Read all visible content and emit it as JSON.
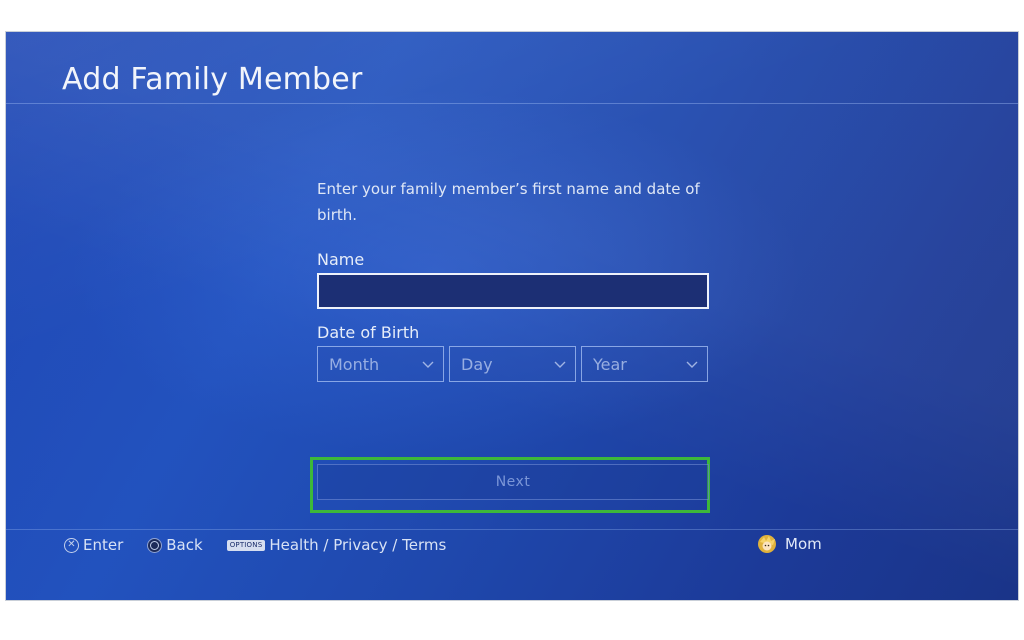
{
  "header": {
    "title": "Add Family Member"
  },
  "form": {
    "instructions": "Enter your family member’s first name and date of birth.",
    "name_label": "Name",
    "name_value": "",
    "dob_label": "Date of Birth",
    "dob": {
      "month_label": "Month",
      "day_label": "Day",
      "year_label": "Year"
    },
    "next_label": "Next"
  },
  "footer": {
    "enter_label": "Enter",
    "back_label": "Back",
    "options_badge": "OPTIONS",
    "links_label": "Health / Privacy / Terms",
    "user_name": "Mom"
  },
  "icons": {
    "enter": "cross-button-icon",
    "back": "circle-button-icon",
    "options": "options-button-icon",
    "avatar": "user-avatar-icon",
    "dropdown": "chevron-down-icon"
  },
  "colors": {
    "background": "#1f48ad",
    "focus_highlight": "#3db83a",
    "text": "#f2f5fb"
  }
}
